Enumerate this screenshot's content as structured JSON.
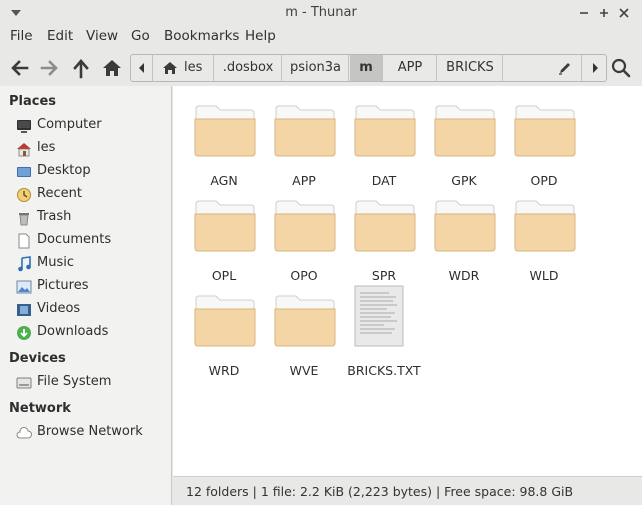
{
  "window": {
    "title": "m - Thunar"
  },
  "menubar": {
    "items": [
      "File",
      "Edit",
      "View",
      "Go",
      "Bookmarks",
      "Help"
    ]
  },
  "pathbar": {
    "segments": [
      {
        "label": "les",
        "icon": "home-icon"
      },
      {
        "label": ".dosbox"
      },
      {
        "label": "psion3a"
      },
      {
        "label": "m",
        "active": true
      },
      {
        "label": "APP"
      },
      {
        "label": "BRICKS"
      }
    ]
  },
  "sidebar": {
    "places_heading": "Places",
    "places": [
      {
        "label": "Computer",
        "icon": "computer-icon"
      },
      {
        "label": "les",
        "icon": "home-icon"
      },
      {
        "label": "Desktop",
        "icon": "desktop-icon"
      },
      {
        "label": "Recent",
        "icon": "recent-icon"
      },
      {
        "label": "Trash",
        "icon": "trash-icon"
      },
      {
        "label": "Documents",
        "icon": "documents-icon"
      },
      {
        "label": "Music",
        "icon": "music-icon"
      },
      {
        "label": "Pictures",
        "icon": "pictures-icon"
      },
      {
        "label": "Videos",
        "icon": "videos-icon"
      },
      {
        "label": "Downloads",
        "icon": "downloads-icon"
      }
    ],
    "devices_heading": "Devices",
    "devices": [
      {
        "label": "File System",
        "icon": "drive-icon"
      }
    ],
    "network_heading": "Network",
    "network": [
      {
        "label": "Browse Network",
        "icon": "network-icon"
      }
    ]
  },
  "files": [
    {
      "name": "AGN",
      "type": "folder"
    },
    {
      "name": "APP",
      "type": "folder"
    },
    {
      "name": "DAT",
      "type": "folder"
    },
    {
      "name": "GPK",
      "type": "folder"
    },
    {
      "name": "OPD",
      "type": "folder"
    },
    {
      "name": "OPL",
      "type": "folder"
    },
    {
      "name": "OPO",
      "type": "folder"
    },
    {
      "name": "SPR",
      "type": "folder"
    },
    {
      "name": "WDR",
      "type": "folder"
    },
    {
      "name": "WLD",
      "type": "folder"
    },
    {
      "name": "WRD",
      "type": "folder"
    },
    {
      "name": "WVE",
      "type": "folder"
    },
    {
      "name": "BRICKS.TXT",
      "type": "text-file"
    }
  ],
  "statusbar": {
    "text": "12 folders  |  1 file: 2.2 KiB (2,223 bytes)  |  Free space: 98.8 GiB"
  },
  "colors": {
    "folder": "#f3d5a6",
    "folder_tab": "#f8f8f6",
    "active_segment": "#c5c5c3"
  }
}
